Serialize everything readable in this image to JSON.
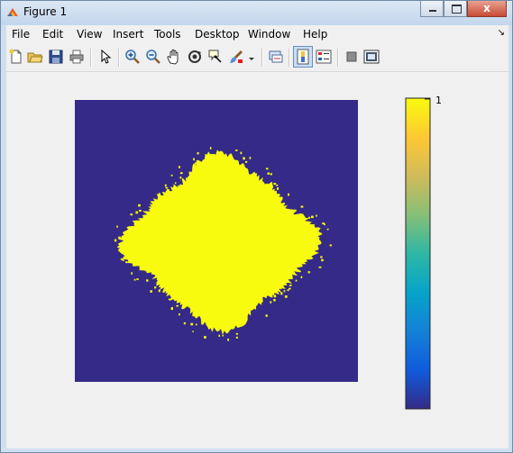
{
  "window": {
    "title": "Figure 1",
    "close_glyph": "x"
  },
  "menu": {
    "items": [
      "File",
      "Edit",
      "View",
      "Insert",
      "Tools",
      "Desktop",
      "Window",
      "Help"
    ],
    "dock_arrow": "↘"
  },
  "toolbar": {
    "icons": [
      "new-figure-icon",
      "open-file-icon",
      "save-icon",
      "print-icon",
      "edit-plot-arrow-icon",
      "zoom-in-icon",
      "zoom-out-icon",
      "pan-hand-icon",
      "rotate-3d-icon",
      "data-cursor-icon",
      "brush-icon",
      "brush-dropdown-icon",
      "link-plot-icon",
      "insert-colorbar-icon",
      "insert-legend-icon",
      "hide-plot-tools-icon",
      "show-plot-tools-icon"
    ]
  },
  "colors": {
    "background": "#352a87",
    "foreground": "#f9fb0e",
    "colormap": "parula"
  },
  "chart_data": {
    "type": "heatmap",
    "title": "",
    "description": "binary image: yellow four-lobed blob (value 1) on dark blue background (value 0)",
    "values": [
      0,
      1
    ],
    "colorbar": {
      "tick_labels": [
        "1"
      ],
      "colormap": [
        "#352a87",
        "#0f5cdd",
        "#1481d6",
        "#06a4ca",
        "#2eb7a4",
        "#87bf77",
        "#d1bb59",
        "#fec832",
        "#f9fb0e"
      ]
    }
  }
}
